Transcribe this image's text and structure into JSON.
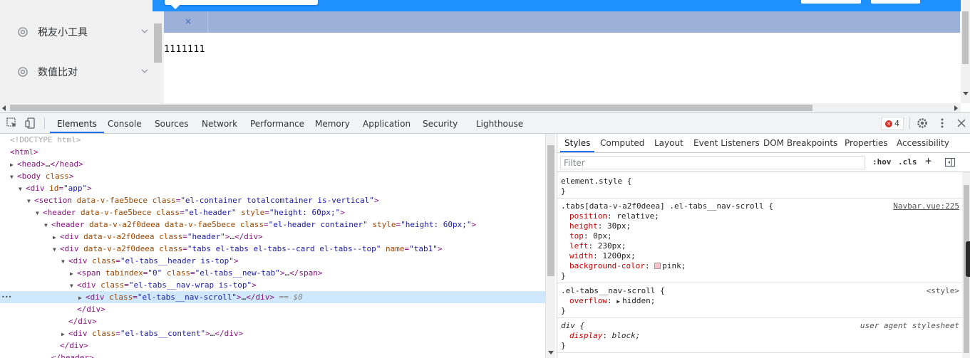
{
  "app": {
    "sidebar": {
      "items": [
        {
          "label": "税友小工具",
          "icon": "gear-icon"
        },
        {
          "label": "数值比对",
          "icon": "gear-icon"
        }
      ]
    },
    "tabs": {
      "close_glyph": "×"
    },
    "content": {
      "text": "1111111"
    }
  },
  "devtools": {
    "toolbar_tabs": [
      "Elements",
      "Console",
      "Sources",
      "Network",
      "Performance",
      "Memory",
      "Application",
      "Security",
      "Lighthouse"
    ],
    "active_tab": "Elements",
    "error_count": "4",
    "error_glyph": "×",
    "elements": {
      "lines": [
        {
          "tokens": [
            {
              "c": "cmt",
              "t": "<!DOCTYPE html>"
            }
          ]
        },
        {
          "tokens": [
            {
              "c": "tag",
              "t": "<html>"
            }
          ]
        },
        {
          "tokens": [
            {
              "c": "tag",
              "t": "<head>"
            },
            {
              "c": "plain",
              "t": "…"
            },
            {
              "c": "tag",
              "t": "</head>"
            }
          ]
        },
        {
          "tokens": [
            {
              "c": "tag",
              "t": "<body "
            },
            {
              "c": "attr",
              "t": "class"
            },
            {
              "c": "tag",
              "t": ">"
            }
          ]
        },
        {
          "tokens": [
            {
              "c": "tag",
              "t": "<div "
            },
            {
              "c": "attr",
              "t": "id"
            },
            {
              "c": "tag",
              "t": "="
            },
            {
              "c": "val",
              "t": "\"app\""
            },
            {
              "c": "tag",
              "t": ">"
            }
          ]
        },
        {
          "tokens": [
            {
              "c": "tag",
              "t": "<section "
            },
            {
              "c": "attr",
              "t": "data-v-fae5bece class"
            },
            {
              "c": "tag",
              "t": "="
            },
            {
              "c": "val",
              "t": "\"el-container totalcomtainer is-vertical\""
            },
            {
              "c": "tag",
              "t": ">"
            }
          ]
        },
        {
          "tokens": [
            {
              "c": "tag",
              "t": "<header "
            },
            {
              "c": "attr",
              "t": "data-v-fae5bece class"
            },
            {
              "c": "tag",
              "t": "="
            },
            {
              "c": "val",
              "t": "\"el-header\""
            },
            {
              "c": "attr",
              "t": " style"
            },
            {
              "c": "tag",
              "t": "="
            },
            {
              "c": "val",
              "t": "\"height: 60px;\""
            },
            {
              "c": "tag",
              "t": ">"
            }
          ]
        },
        {
          "tokens": [
            {
              "c": "tag",
              "t": "<header "
            },
            {
              "c": "attr",
              "t": "data-v-a2f0deea data-v-fae5bece class"
            },
            {
              "c": "tag",
              "t": "="
            },
            {
              "c": "val",
              "t": "\"el-header container\""
            },
            {
              "c": "attr",
              "t": " style"
            },
            {
              "c": "tag",
              "t": "="
            },
            {
              "c": "val",
              "t": "\"height: 60px;\""
            },
            {
              "c": "tag",
              "t": ">"
            }
          ]
        },
        {
          "tokens": [
            {
              "c": "tag",
              "t": "<div "
            },
            {
              "c": "attr",
              "t": "data-v-a2f0deea class"
            },
            {
              "c": "tag",
              "t": "="
            },
            {
              "c": "val",
              "t": "\"header\""
            },
            {
              "c": "tag",
              "t": ">"
            },
            {
              "c": "plain",
              "t": "…"
            },
            {
              "c": "tag",
              "t": "</div>"
            }
          ]
        },
        {
          "tokens": [
            {
              "c": "tag",
              "t": "<div "
            },
            {
              "c": "attr",
              "t": "data-v-a2f0deea class"
            },
            {
              "c": "tag",
              "t": "="
            },
            {
              "c": "val",
              "t": "\"tabs el-tabs el-tabs--card el-tabs--top\""
            },
            {
              "c": "attr",
              "t": " name"
            },
            {
              "c": "tag",
              "t": "="
            },
            {
              "c": "val",
              "t": "\"tab1\""
            },
            {
              "c": "tag",
              "t": ">"
            }
          ]
        },
        {
          "tokens": [
            {
              "c": "tag",
              "t": "<div "
            },
            {
              "c": "attr",
              "t": "class"
            },
            {
              "c": "tag",
              "t": "="
            },
            {
              "c": "val",
              "t": "\"el-tabs__header is-top\""
            },
            {
              "c": "tag",
              "t": ">"
            }
          ]
        },
        {
          "tokens": [
            {
              "c": "tag",
              "t": "<span "
            },
            {
              "c": "attr",
              "t": "tabindex"
            },
            {
              "c": "tag",
              "t": "="
            },
            {
              "c": "val",
              "t": "\"0\""
            },
            {
              "c": "attr",
              "t": " class"
            },
            {
              "c": "tag",
              "t": "="
            },
            {
              "c": "val",
              "t": "\"el-tabs__new-tab\""
            },
            {
              "c": "tag",
              "t": ">"
            },
            {
              "c": "plain",
              "t": "…"
            },
            {
              "c": "tag",
              "t": "</span>"
            }
          ]
        },
        {
          "tokens": [
            {
              "c": "tag",
              "t": "<div "
            },
            {
              "c": "attr",
              "t": "class"
            },
            {
              "c": "tag",
              "t": "="
            },
            {
              "c": "val",
              "t": "\"el-tabs__nav-wrap is-top\""
            },
            {
              "c": "tag",
              "t": ">"
            }
          ]
        },
        {
          "tokens": [
            {
              "c": "tag",
              "t": "<div "
            },
            {
              "c": "attr",
              "t": "class"
            },
            {
              "c": "tag",
              "t": "="
            },
            {
              "c": "val",
              "t": "\"el-tabs__nav-scroll\""
            },
            {
              "c": "tag",
              "t": ">"
            },
            {
              "c": "plain",
              "t": "…"
            },
            {
              "c": "tag",
              "t": "</div>"
            },
            {
              "c": "eq0",
              "t": " == $0"
            }
          ]
        },
        {
          "tokens": [
            {
              "c": "tag",
              "t": "</div>"
            }
          ]
        },
        {
          "tokens": [
            {
              "c": "tag",
              "t": "</div>"
            }
          ]
        },
        {
          "tokens": [
            {
              "c": "tag",
              "t": "<div "
            },
            {
              "c": "attr",
              "t": "class"
            },
            {
              "c": "tag",
              "t": "="
            },
            {
              "c": "val",
              "t": "\"el-tabs__content\""
            },
            {
              "c": "tag",
              "t": ">"
            },
            {
              "c": "plain",
              "t": "…"
            },
            {
              "c": "tag",
              "t": "</div>"
            }
          ]
        },
        {
          "tokens": [
            {
              "c": "tag",
              "t": "</div>"
            }
          ]
        },
        {
          "tokens": [
            {
              "c": "tag",
              "t": "</header>"
            }
          ]
        }
      ],
      "dots": "•••"
    },
    "styles": {
      "tabs": [
        "Styles",
        "Computed",
        "Layout",
        "Event Listeners",
        "DOM Breakpoints",
        "Properties",
        "Accessibility"
      ],
      "active_tab": "Styles",
      "filter_placeholder": "Filter",
      "hov": ":hov",
      "cls": ".cls",
      "plus": "+",
      "rules": [
        {
          "selector": "element.style {",
          "source": "",
          "decls": [],
          "close": "}"
        },
        {
          "selector": ".tabs[data-v-a2f0deea] .el-tabs__nav-scroll {",
          "source": "Navbar.vue:225",
          "decls": [
            {
              "p": "position",
              "v": "relative;"
            },
            {
              "p": "height",
              "v": "30px;"
            },
            {
              "p": "top",
              "v": "0px;"
            },
            {
              "p": "left",
              "v": "230px;"
            },
            {
              "p": "width",
              "v": "1200px;"
            },
            {
              "p": "background-color",
              "v": "pink;",
              "swatch": "#ffc0cb"
            }
          ],
          "close": "}"
        },
        {
          "selector": ".el-tabs__nav-scroll {",
          "source": "<style>",
          "decls": [
            {
              "p": "overflow",
              "v": "hidden;",
              "expander": "▶"
            }
          ],
          "close": "}"
        },
        {
          "selector": "div {",
          "source": "user agent stylesheet",
          "decls": [
            {
              "p": "display",
              "v": "block;"
            }
          ],
          "close": "}"
        }
      ]
    }
  },
  "colors": {
    "topbar": "#1e90ff",
    "tabsbar": "#9db0d8",
    "selected_row": "#cfe8fc",
    "active_underline": "#1a73e8"
  }
}
